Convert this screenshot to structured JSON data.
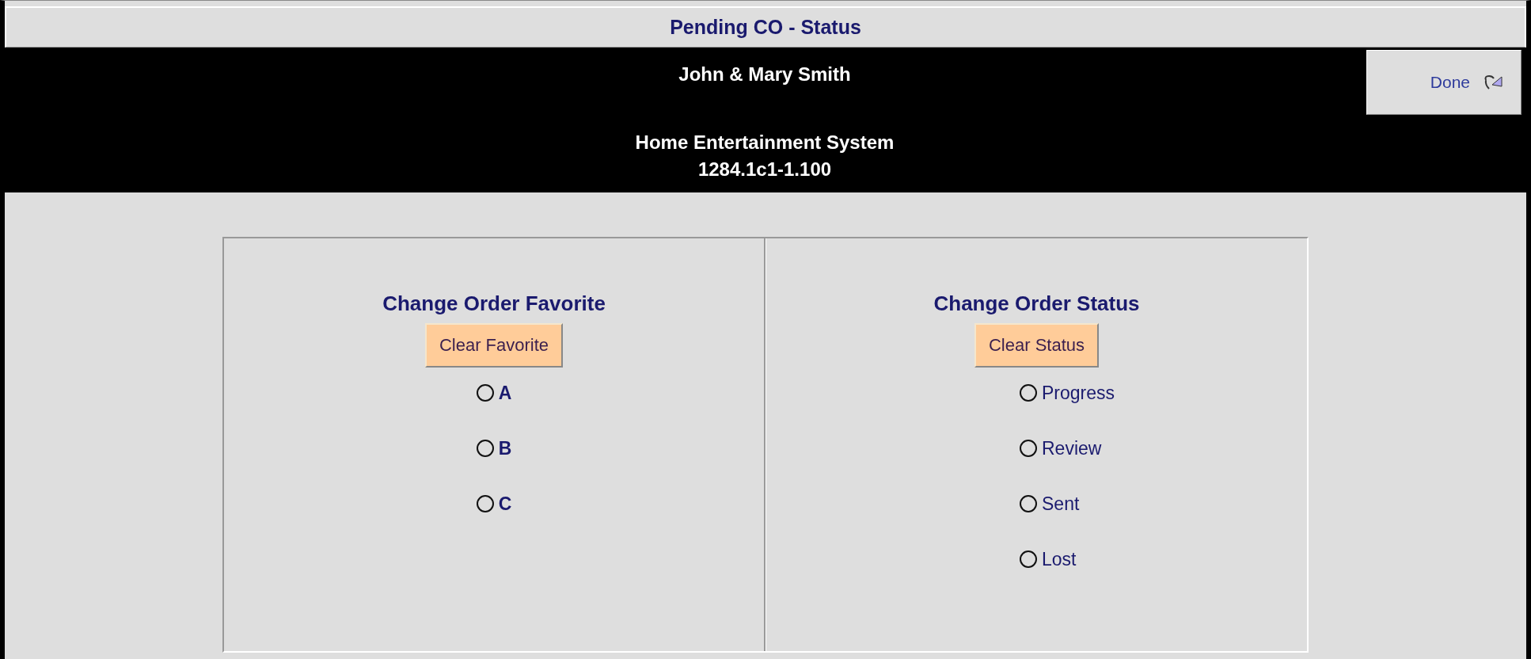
{
  "window": {
    "title": "Pending CO - Status"
  },
  "header": {
    "customer": "John & Mary Smith",
    "project": "Home Entertainment System",
    "number": "1284.1c1-1.100"
  },
  "done_button": {
    "label": "Done"
  },
  "sections": [
    {
      "title": "Change Order Favorite",
      "button": "Clear Favorite",
      "kind": "favorite",
      "options": [
        {
          "label": "A",
          "selected": false
        },
        {
          "label": "B",
          "selected": false
        },
        {
          "label": "C",
          "selected": false
        }
      ]
    },
    {
      "title": "Change Order Status",
      "button": "Clear Status",
      "kind": "status",
      "options": [
        {
          "label": "Progress",
          "selected": false
        },
        {
          "label": "Review",
          "selected": false
        },
        {
          "label": "Sent",
          "selected": false
        },
        {
          "label": "Lost",
          "selected": false
        }
      ]
    }
  ]
}
